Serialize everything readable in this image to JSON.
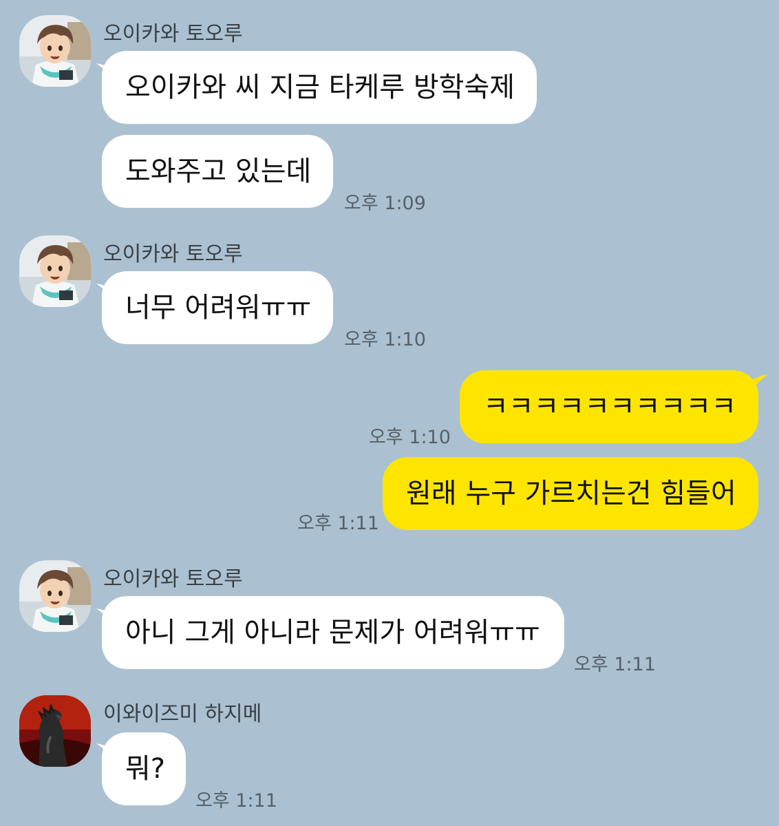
{
  "colors": {
    "background": "#abc1d1",
    "incoming_bubble": "#ffffff",
    "outgoing_bubble": "#fee500"
  },
  "messages": [
    {
      "sender": "오이카와 토오루",
      "text": "오이카와 씨 지금 타케루 방학숙제",
      "time": ""
    },
    {
      "sender": "",
      "text": "도와주고 있는데",
      "time": "오후 1:09"
    },
    {
      "sender": "오이카와 토오루",
      "text": "너무 어려워ㅠㅠ",
      "time": "오후 1:10"
    },
    {
      "sender": "me",
      "text": "ㅋㅋㅋㅋㅋㅋㅋㅋㅋㅋ",
      "time": "오후 1:10"
    },
    {
      "sender": "me",
      "text": "원래 누구 가르치는건 힘들어",
      "time": "오후 1:11"
    },
    {
      "sender": "오이카와 토오루",
      "text": "아니 그게 아니라 문제가 어려워ㅠㅠ",
      "time": "오후 1:11"
    },
    {
      "sender": "이와이즈미 하지메",
      "text": "뭐?",
      "time": "오후 1:11"
    }
  ],
  "avatars": {
    "oikawa": "anime-character-avatar",
    "iwaizumi": "godzilla-avatar"
  }
}
